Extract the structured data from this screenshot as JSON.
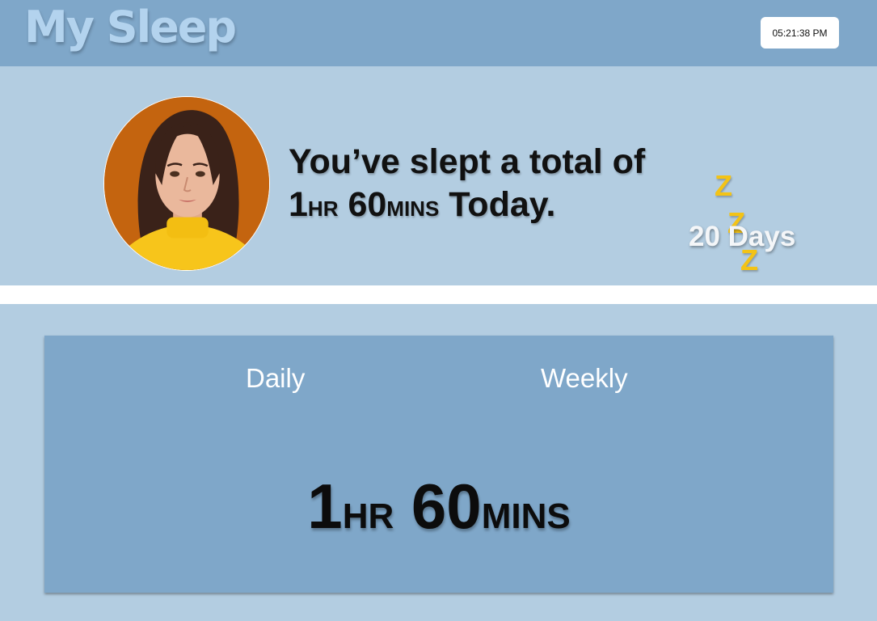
{
  "header": {
    "title": "My Sleep",
    "time": "05:21:38 PM"
  },
  "profile": {
    "summary_prefix": "You’ve slept a total of",
    "hours_value": "1",
    "hours_unit": "HR",
    "minutes_value": "60",
    "minutes_unit": "MINS",
    "summary_suffix": "Today.",
    "zzz": [
      "Z",
      "Z",
      "Z"
    ],
    "streak": "20 Days"
  },
  "stats": {
    "tabs": [
      {
        "label": "Daily"
      },
      {
        "label": "Weekly"
      }
    ],
    "total": {
      "hours_value": "1",
      "hours_unit": "HR",
      "minutes_value": "60",
      "minutes_unit": "MINS"
    }
  },
  "colors": {
    "header_bg": "#7fa7c9",
    "page_bg": "#b3cde1",
    "title": "#b3d3ee",
    "zzz": "#f3c316",
    "card_bg": "#7fa7c9"
  }
}
